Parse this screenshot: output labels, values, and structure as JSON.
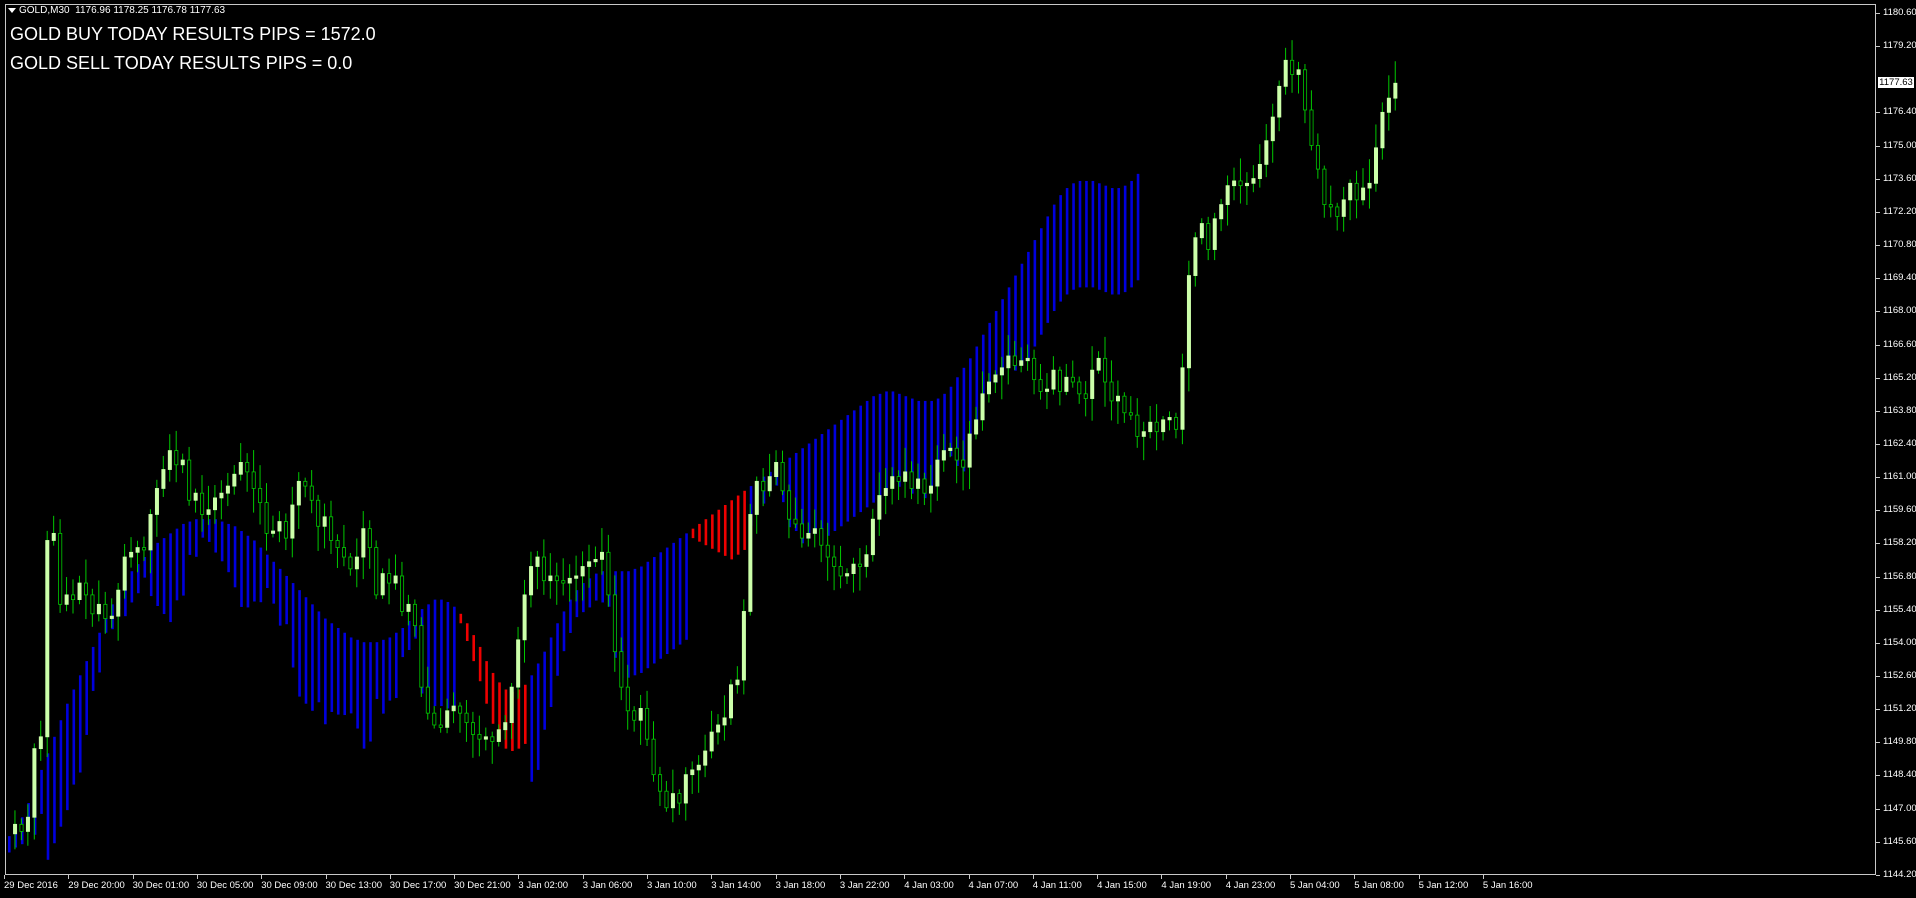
{
  "header": {
    "symbol": "GOLD,M30",
    "ohlc": "1176.96 1178.25 1176.78 1177.63"
  },
  "results": {
    "buy": "GOLD BUY TODAY RESULTS PIPS = 1572.0",
    "sell": "GOLD SELL TODAY RESULTS PIPS = 0.0"
  },
  "price_axis": {
    "ticks": [
      "1180.60",
      "1179.20",
      "1177.63",
      "1176.40",
      "1175.00",
      "1173.60",
      "1172.20",
      "1170.80",
      "1169.40",
      "1168.00",
      "1166.60",
      "1165.20",
      "1163.80",
      "1162.40",
      "1161.00",
      "1159.60",
      "1158.20",
      "1156.80",
      "1155.40",
      "1154.00",
      "1152.60",
      "1151.20",
      "1149.80",
      "1148.40",
      "1147.00",
      "1145.60",
      "1144.20"
    ],
    "current_price": "1177.63"
  },
  "time_axis": {
    "labels": [
      "29 Dec 2016",
      "29 Dec 20:00",
      "30 Dec 01:00",
      "30 Dec 05:00",
      "30 Dec 09:00",
      "30 Dec 13:00",
      "30 Dec 17:00",
      "30 Dec 21:00",
      "3 Jan 02:00",
      "3 Jan 06:00",
      "3 Jan 10:00",
      "3 Jan 14:00",
      "3 Jan 18:00",
      "3 Jan 22:00",
      "4 Jan 03:00",
      "4 Jan 07:00",
      "4 Jan 11:00",
      "4 Jan 15:00",
      "4 Jan 19:00",
      "4 Jan 23:00",
      "5 Jan 04:00",
      "5 Jan 08:00",
      "5 Jan 12:00",
      "5 Jan 16:00"
    ]
  },
  "colors": {
    "background": "#000000",
    "bull_candle": "#ccffaa",
    "wick": "#00c800",
    "band_up": "#0000dd",
    "band_down": "#ee0000",
    "frame": "#c8c8c8"
  },
  "chart_data": {
    "type": "candlestick",
    "symbol": "GOLD",
    "timeframe": "M30",
    "ylim": [
      1144.2,
      1180.6
    ],
    "close_path": [
      1145.9,
      1146.3,
      1146.0,
      1146.6,
      1149.5,
      1150.0,
      1158.3,
      1158.6,
      1155.6,
      1156.0,
      1155.8,
      1156.5,
      1156.0,
      1155.2,
      1155.6,
      1155.0,
      1155.1,
      1156.2,
      1157.6,
      1157.8,
      1158.0,
      1157.9,
      1159.4,
      1160.5,
      1161.3,
      1162.1,
      1161.5,
      1161.7,
      1160.0,
      1160.3,
      1159.4,
      1159.6,
      1160.1,
      1160.3,
      1160.6,
      1161.1,
      1161.6,
      1161.2,
      1160.5,
      1159.9,
      1158.6,
      1158.7,
      1159.1,
      1158.4,
      1159.8,
      1160.8,
      1160.6,
      1160.0,
      1158.9,
      1159.3,
      1158.3,
      1158.0,
      1157.6,
      1157.1,
      1157.6,
      1158.8,
      1158.0,
      1156.0,
      1156.9,
      1156.5,
      1156.8,
      1155.3,
      1155.6,
      1154.7,
      1152.1,
      1151.0,
      1150.5,
      1150.4,
      1151.1,
      1151.3,
      1151.0,
      1150.6,
      1150.1,
      1149.9,
      1150.0,
      1149.8,
      1150.3,
      1150.6,
      1152.1,
      1154.1,
      1156.0,
      1157.2,
      1157.6,
      1156.6,
      1156.8,
      1156.6,
      1156.5,
      1156.7,
      1156.8,
      1157.2,
      1157.4,
      1157.5,
      1157.8,
      1156.0,
      1153.6,
      1152.1,
      1151.1,
      1150.7,
      1151.2,
      1149.9,
      1148.4,
      1147.7,
      1147.0,
      1147.6,
      1147.2,
      1148.4,
      1148.6,
      1148.8,
      1149.4,
      1150.2,
      1150.5,
      1150.8,
      1152.2,
      1152.4,
      1155.3,
      1159.4,
      1160.8,
      1160.4,
      1161.0,
      1161.6,
      1160.4,
      1159.2,
      1159.0,
      1158.4,
      1158.6,
      1158.8,
      1158.1,
      1157.6,
      1157.2,
      1156.8,
      1156.9,
      1157.3,
      1157.2,
      1157.7,
      1159.2,
      1160.2,
      1160.5,
      1161.0,
      1160.8,
      1161.2,
      1160.5,
      1160.9,
      1160.3,
      1160.6,
      1161.7,
      1162.1,
      1162.2,
      1161.7,
      1161.4,
      1162.8,
      1163.4,
      1164.5,
      1165.0,
      1165.3,
      1165.6,
      1166.1,
      1165.7,
      1165.9,
      1166.0,
      1165.1,
      1164.6,
      1164.7,
      1165.5,
      1164.6,
      1165.2,
      1165.0,
      1164.5,
      1164.3,
      1165.5,
      1166.0,
      1165.0,
      1164.2,
      1164.4,
      1163.7,
      1163.6,
      1162.7,
      1162.9,
      1163.3,
      1162.9,
      1163.4,
      1163.5,
      1163.0,
      1165.6,
      1169.5,
      1171.1,
      1171.7,
      1170.6,
      1171.9,
      1172.5,
      1173.3,
      1173.5,
      1173.3,
      1173.4,
      1173.6,
      1174.2,
      1175.2,
      1176.2,
      1177.5,
      1178.6,
      1178.0,
      1178.2,
      1176.5,
      1175.0,
      1174.0,
      1172.5,
      1172.4,
      1172.0,
      1172.7,
      1173.4,
      1172.7,
      1173.2,
      1173.4,
      1174.9,
      1176.4,
      1177.0,
      1177.63
    ],
    "band_upper_path": [
      1145.8,
      1146.1,
      1146.6,
      1147.2,
      1147.9,
      1148.6,
      1149.3,
      1150.0,
      1150.7,
      1151.4,
      1152.0,
      1152.6,
      1153.2,
      1153.8,
      1154.4,
      1155.0,
      1155.6,
      1156.1,
      1156.6,
      1157.0,
      1157.3,
      1157.6,
      1157.9,
      1158.2,
      1158.4,
      1158.6,
      1158.8,
      1159.0,
      1159.1,
      1159.2,
      1159.2,
      1159.2,
      1159.2,
      1159.1,
      1159.0,
      1158.9,
      1158.7,
      1158.5,
      1158.3,
      1158.0,
      1157.7,
      1157.4,
      1157.1,
      1156.8,
      1156.5,
      1156.2,
      1155.9,
      1155.6,
      1155.3,
      1155.0,
      1154.8,
      1154.6,
      1154.4,
      1154.2,
      1154.1,
      1154.0,
      1154.0,
      1154.0,
      1154.1,
      1154.2,
      1154.4,
      1154.6,
      1154.9,
      1155.2,
      1155.4,
      1155.6,
      1155.8,
      1155.8,
      1155.7,
      1155.5,
      1155.2,
      1154.8,
      1154.3,
      1153.8,
      1153.2,
      1152.7,
      1152.3,
      1152.0,
      1151.9,
      1152.0,
      1152.2,
      1152.6,
      1153.1,
      1153.6,
      1154.2,
      1154.8,
      1155.3,
      1155.8,
      1156.2,
      1156.5,
      1156.7,
      1156.9,
      1157.0,
      1157.0,
      1157.0,
      1157.0,
      1157.0,
      1157.1,
      1157.2,
      1157.4,
      1157.6,
      1157.8,
      1158.0,
      1158.2,
      1158.4,
      1158.6,
      1158.8,
      1159.0,
      1159.2,
      1159.4,
      1159.6,
      1159.8,
      1160.0,
      1160.2,
      1160.4,
      1160.6,
      1160.8,
      1161.0,
      1161.2,
      1161.4,
      1161.6,
      1161.8,
      1162.0,
      1162.2,
      1162.4,
      1162.6,
      1162.8,
      1163.0,
      1163.2,
      1163.4,
      1163.6,
      1163.8,
      1164.0,
      1164.2,
      1164.4,
      1164.5,
      1164.6,
      1164.6,
      1164.5,
      1164.4,
      1164.3,
      1164.2,
      1164.2,
      1164.2,
      1164.3,
      1164.5,
      1164.8,
      1165.2,
      1165.6,
      1166.0,
      1166.5,
      1167.0,
      1167.5,
      1168.0,
      1168.5,
      1169.0,
      1169.5,
      1170.0,
      1170.5,
      1171.0,
      1171.5,
      1172.0,
      1172.5,
      1172.9,
      1173.2,
      1173.4,
      1173.5,
      1173.5,
      1173.5,
      1173.4,
      1173.3,
      1173.2,
      1173.2,
      1173.3,
      1173.5,
      1173.8
    ],
    "band_down_segments": [
      [
        70,
        80
      ],
      [
        106,
        114
      ]
    ]
  }
}
